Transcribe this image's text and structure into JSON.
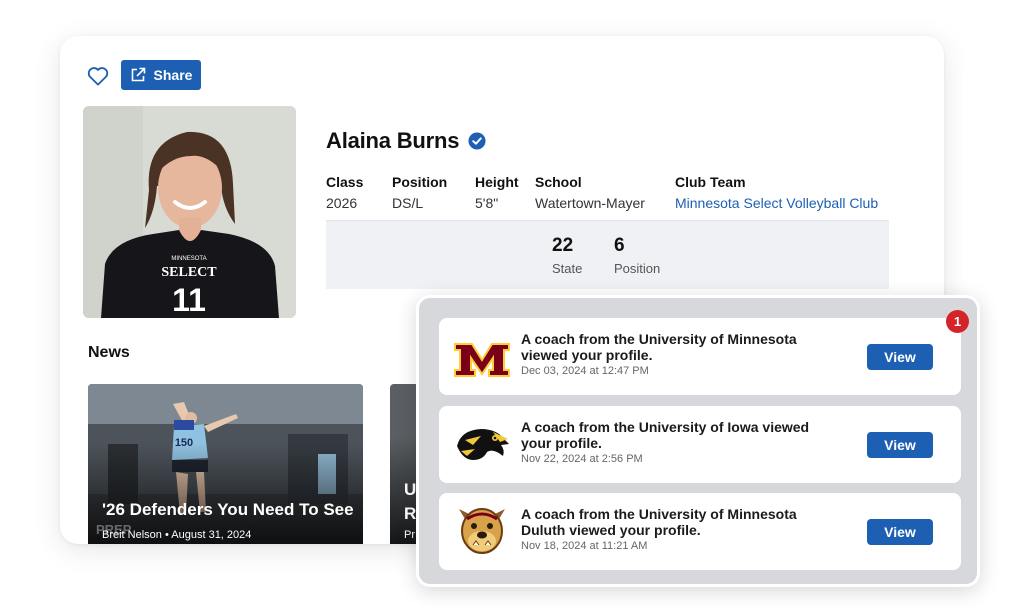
{
  "profile": {
    "share_label": "Share",
    "name": "Alaina Burns",
    "fields": [
      {
        "label": "Class",
        "value": "2026"
      },
      {
        "label": "Position",
        "value": "DS/L"
      },
      {
        "label": "Height",
        "value": "5'8\""
      },
      {
        "label": "School",
        "value": "Watertown-Mayer"
      },
      {
        "label": "Club Team",
        "value": "Minnesota Select Volleyball Club"
      }
    ],
    "stats": [
      {
        "number": "22",
        "label": "State"
      },
      {
        "number": "6",
        "label": "Position"
      }
    ],
    "jersey": {
      "top": "MINNESOTA",
      "word": "SELECT",
      "number": "11"
    }
  },
  "news": {
    "title": "News",
    "items": [
      {
        "headline": "'26 Defenders You Need To See",
        "byline": "Breit Nelson • August 31, 2024",
        "jersey_number": "150",
        "overlay_text": "PREP"
      },
      {
        "headline": "U\nRa",
        "byline": "Pr"
      }
    ]
  },
  "notifications": {
    "badge_count": "1",
    "items": [
      {
        "message": "A coach from the University of Minnesota viewed your profile.",
        "time": "Dec 03, 2024 at 12:47 PM",
        "button": "View",
        "logo": "minnesota-m-logo"
      },
      {
        "message": "A coach from the University of Iowa viewed your profile.",
        "time": "Nov 22, 2024 at 2:56 PM",
        "button": "View",
        "logo": "iowa-hawkeye-logo"
      },
      {
        "message": "A coach from the University of Minnesota Duluth viewed your profile.",
        "time": "Nov 18, 2024 at 11:21 AM",
        "button": "View",
        "logo": "umd-bulldog-logo"
      }
    ]
  },
  "colors": {
    "accent": "#1d5fb3",
    "badge": "#d42427",
    "minnesota_maroon": "#7a0019",
    "minnesota_gold": "#ffcc33"
  }
}
